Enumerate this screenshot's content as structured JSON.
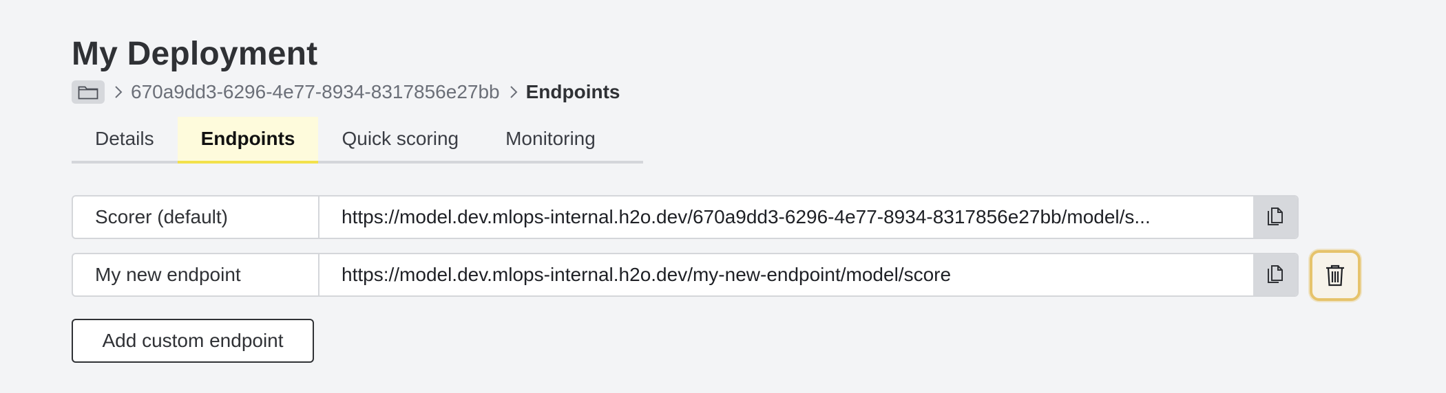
{
  "page": {
    "title": "My Deployment"
  },
  "breadcrumb": {
    "folder_icon": "folder-icon",
    "separator_icon": "chevron-right-icon",
    "items": [
      {
        "label": "670a9dd3-6296-4e77-8934-8317856e27bb"
      },
      {
        "label": "Endpoints"
      }
    ]
  },
  "tabs": [
    {
      "label": "Details",
      "active": false
    },
    {
      "label": "Endpoints",
      "active": true
    },
    {
      "label": "Quick scoring",
      "active": false
    },
    {
      "label": "Monitoring",
      "active": false
    }
  ],
  "endpoints": [
    {
      "name": "Scorer (default)",
      "url": "https://model.dev.mlops-internal.h2o.dev/670a9dd3-6296-4e77-8934-8317856e27bb/model/s...",
      "copy_icon": "copy-icon"
    },
    {
      "name": "My new endpoint",
      "url": "https://model.dev.mlops-internal.h2o.dev/my-new-endpoint/model/score",
      "copy_icon": "copy-icon",
      "delete_icon": "trash-icon"
    }
  ],
  "actions": {
    "add_endpoint_label": "Add custom endpoint"
  },
  "colors": {
    "background": "#f3f4f6",
    "active_tab_bg": "#fefbdc",
    "active_tab_underline": "#f2e14b",
    "delete_focus_ring": "#e6c36b"
  }
}
